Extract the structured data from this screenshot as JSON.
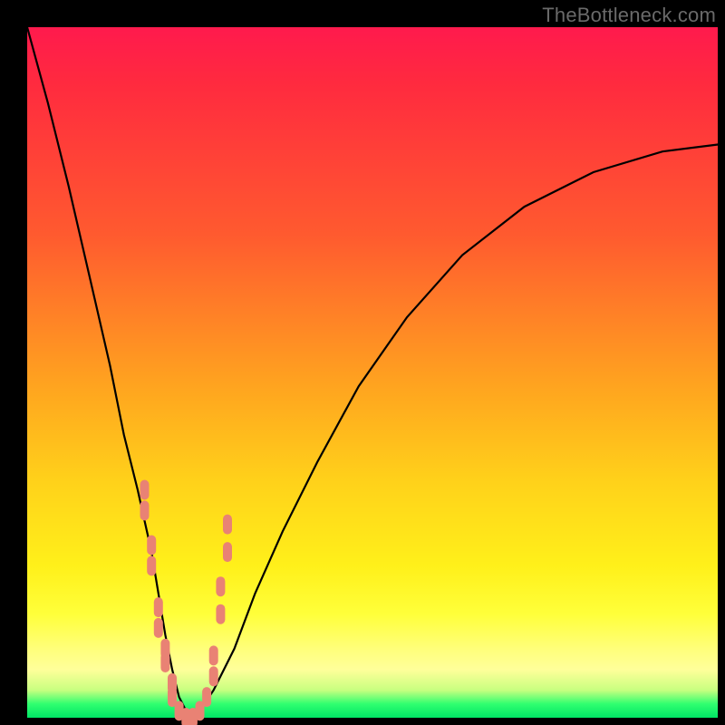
{
  "watermark": "TheBottleneck.com",
  "colors": {
    "frame": "#000000",
    "gradient_top": "#ff1a4d",
    "gradient_mid": "#ffd21a",
    "gradient_bottom": "#00e565",
    "curve": "#000000",
    "marker": "#e98274"
  },
  "chart_data": {
    "type": "line",
    "title": "",
    "xlabel": "",
    "ylabel": "",
    "xlim": [
      0,
      100
    ],
    "ylim": [
      0,
      100
    ],
    "note": "No numeric tick labels are shown; values are estimated from pixel positions on a 0-100 normalized scale for both axes. The curve resembles a V-shaped bottleneck notch.",
    "series": [
      {
        "name": "bottleneck-curve",
        "x": [
          0,
          3,
          6,
          9,
          12,
          14,
          16,
          18,
          19,
          20,
          21,
          22,
          23,
          24,
          25,
          27,
          30,
          33,
          37,
          42,
          48,
          55,
          63,
          72,
          82,
          92,
          100
        ],
        "y": [
          100,
          89,
          77,
          64,
          51,
          41,
          33,
          24,
          18,
          12,
          7,
          3,
          1,
          0,
          1,
          4,
          10,
          18,
          27,
          37,
          48,
          58,
          67,
          74,
          79,
          82,
          83
        ]
      }
    ],
    "markers": {
      "name": "highlight-dots",
      "shape": "rounded-bar",
      "approx_color": "#e98274",
      "points_xy": [
        [
          17,
          33
        ],
        [
          17,
          30
        ],
        [
          18,
          25
        ],
        [
          18,
          22
        ],
        [
          19,
          16
        ],
        [
          19,
          13
        ],
        [
          20,
          10
        ],
        [
          20,
          8
        ],
        [
          21,
          5
        ],
        [
          21,
          3
        ],
        [
          22,
          1
        ],
        [
          23,
          0
        ],
        [
          24,
          0
        ],
        [
          25,
          1
        ],
        [
          26,
          3
        ],
        [
          27,
          6
        ],
        [
          27,
          9
        ],
        [
          28,
          15
        ],
        [
          28,
          19
        ],
        [
          29,
          24
        ],
        [
          29,
          28
        ]
      ]
    }
  }
}
